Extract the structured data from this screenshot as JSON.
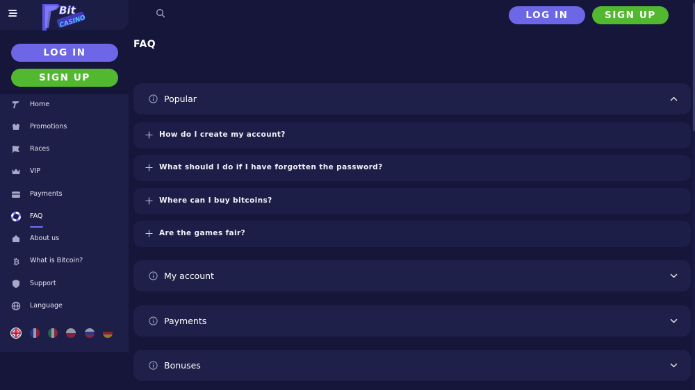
{
  "header": {
    "logo_text": "Bit Casino",
    "login_label": "LOG IN",
    "signup_label": "SIGN UP"
  },
  "sidebar": {
    "login_label": "LOG IN",
    "signup_label": "SIGN UP",
    "items": [
      {
        "label": "Home",
        "icon": "home-logo-icon",
        "active": false
      },
      {
        "label": "Promotions",
        "icon": "promotions-icon",
        "active": false
      },
      {
        "label": "Races",
        "icon": "flag-icon",
        "active": false
      },
      {
        "label": "VIP",
        "icon": "crown-icon",
        "active": false
      },
      {
        "label": "Payments",
        "icon": "wallet-icon",
        "active": false
      },
      {
        "label": "FAQ",
        "icon": "lifebuoy-icon",
        "active": true
      },
      {
        "label": "About us",
        "icon": "house-icon",
        "active": false
      },
      {
        "label": "What is Bitcoin?",
        "icon": "bitcoin-icon",
        "active": false
      },
      {
        "label": "Support",
        "icon": "shield-icon",
        "active": false
      },
      {
        "label": "Language",
        "icon": "globe-icon",
        "active": false
      }
    ],
    "languages": [
      "en",
      "fr",
      "it",
      "pl",
      "ru",
      "de"
    ]
  },
  "page": {
    "title": "FAQ"
  },
  "faq": {
    "categories": [
      {
        "label": "Popular",
        "expanded": true,
        "questions": [
          "How do I create my account?",
          "What should I do if I have forgotten the password?",
          "Where can I buy bitcoins?",
          "Are the games fair?"
        ]
      },
      {
        "label": "My account",
        "expanded": false
      },
      {
        "label": "Payments",
        "expanded": false
      },
      {
        "label": "Bonuses",
        "expanded": false
      }
    ]
  },
  "colors": {
    "background": "#15163a",
    "panel": "#1f2049",
    "login_accent": "#6d67e8",
    "signup_accent": "#52b82f",
    "active_underline": "#7570ee"
  }
}
